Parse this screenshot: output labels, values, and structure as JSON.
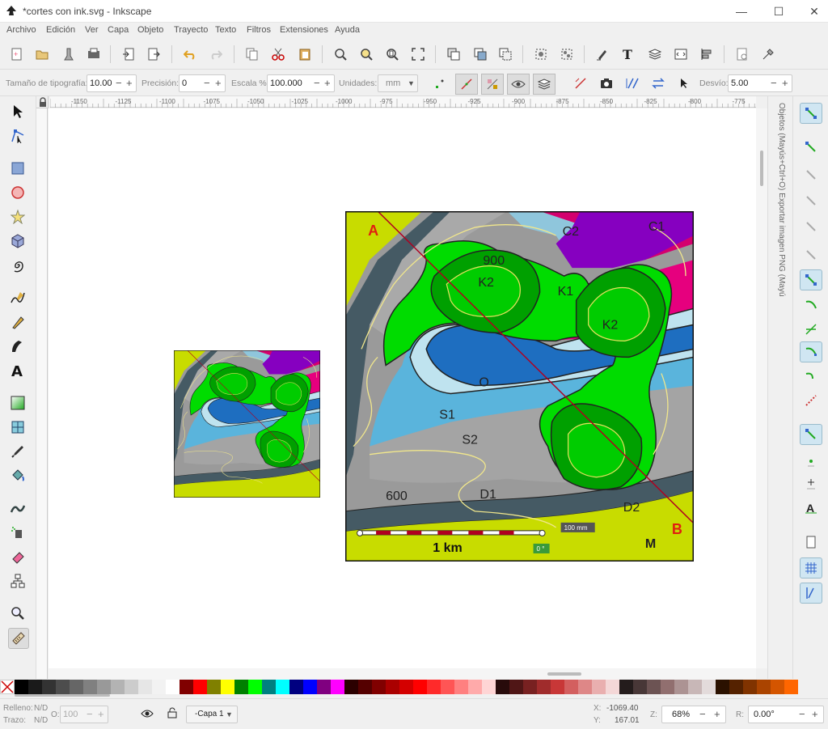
{
  "window": {
    "title": "*cortes con ink.svg - Inkscape",
    "minimize": "—",
    "maximize": "☐",
    "close": "✕"
  },
  "menu": [
    "Archivo",
    "Edición",
    "Ver",
    "Capa",
    "Objeto",
    "Trayecto",
    "Texto",
    "Filtros",
    "Extensiones",
    "Ayuda"
  ],
  "toolctl": {
    "font_size_label": "Tamaño de tipografía:",
    "font_size": "10.00",
    "precision_label": "Precisión:",
    "precision": "0",
    "scale_label": "Escala %:",
    "scale": "100.000",
    "units_label": "Unidades:",
    "units": "mm",
    "offset_label": "Desvío:",
    "offset": "5.00"
  },
  "ruler_ticks": [
    "-1150",
    "-1125",
    "-1100",
    "-1075",
    "-1050",
    "-1025",
    "-1000",
    "-975",
    "-950",
    "-925",
    "-900",
    "-875",
    "-850",
    "-825",
    "-800",
    "-775"
  ],
  "dock_tabs": "Objetos (Mayús+Ctrl+O)  Exportar imagen PNG (Mayús+Ctrl+E)",
  "map": {
    "labels": {
      "A": "A",
      "B": "B",
      "C1": "C1",
      "C2": "C2",
      "K1": "K1",
      "K2a": "K2",
      "K2b": "K2",
      "O": "O",
      "S1": "S1",
      "S2": "S2",
      "D1": "D1",
      "D2": "D2",
      "M": "M",
      "c900": "900",
      "c600": "600"
    },
    "scale_text": "1 km",
    "measure_text": "100 mm",
    "angle_text": "0 °"
  },
  "palette_colors": [
    "#000000",
    "#1a1a1a",
    "#333333",
    "#4d4d4d",
    "#666666",
    "#808080",
    "#999999",
    "#b3b3b3",
    "#cccccc",
    "#e6e6e6",
    "#f2f2f2",
    "#ffffff",
    "#800000",
    "#ff0000",
    "#808000",
    "#ffff00",
    "#008000",
    "#00ff00",
    "#008080",
    "#00ffff",
    "#000080",
    "#0000ff",
    "#800080",
    "#ff00ff",
    "#2b0000",
    "#550000",
    "#800000",
    "#aa0000",
    "#d40000",
    "#ff0000",
    "#ff2a2a",
    "#ff5555",
    "#ff8080",
    "#ffaaaa",
    "#ffd5d5",
    "#280b0b",
    "#501616",
    "#782121",
    "#a02c2c",
    "#c83737",
    "#d35f5f",
    "#de8787",
    "#e9afaf",
    "#f4d7d7",
    "#241c1c",
    "#483737",
    "#6c5353",
    "#916f6f",
    "#ac9393",
    "#c8b7b7",
    "#e3dbdb",
    "#2b1100",
    "#552200",
    "#803300",
    "#aa4400",
    "#d45500",
    "#ff6600"
  ],
  "status": {
    "fill_label": "Relleno:",
    "fill_value": "N/D",
    "stroke_label": "Trazo:",
    "stroke_value": "N/D",
    "opacity_label": "O:",
    "opacity": "100",
    "layer": "-Capa 1",
    "x_label": "X:",
    "x": "-1069.40",
    "y_label": "Y:",
    "y": "167.01",
    "zoom_label": "Z:",
    "zoom": "68%",
    "rot_label": "R:",
    "rotation": "0.00°"
  }
}
